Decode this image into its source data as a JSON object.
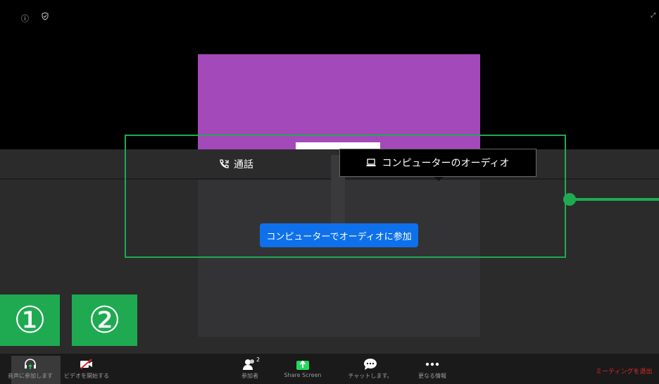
{
  "top_bar": {
    "info_icon": "info-icon",
    "shield_icon": "shield-check-icon",
    "fullscreen_icon": "fullscreen-icon"
  },
  "audio_dialog": {
    "tab_phone_label": "通話",
    "tab_computer_label": "コンピューターのオーディオ",
    "join_button_label": "コンピューターでオーディオに参加"
  },
  "annotations": {
    "marker1": "①",
    "marker2": "②",
    "highlight_color": "#1faa52"
  },
  "toolbar": {
    "audio_label": "音声に参加します",
    "video_label": "ビデオを開始する",
    "participants_label": "参加者",
    "participants_count": "2",
    "share_label": "Share Screen",
    "chat_label": "チャットします。",
    "more_label": "更なる情報",
    "leave_label": "ミーティングを退出"
  },
  "colors": {
    "accent_blue": "#0e71eb",
    "share_green": "#23d959",
    "leave_red": "#e02828",
    "video_tile": "#a349b9"
  }
}
